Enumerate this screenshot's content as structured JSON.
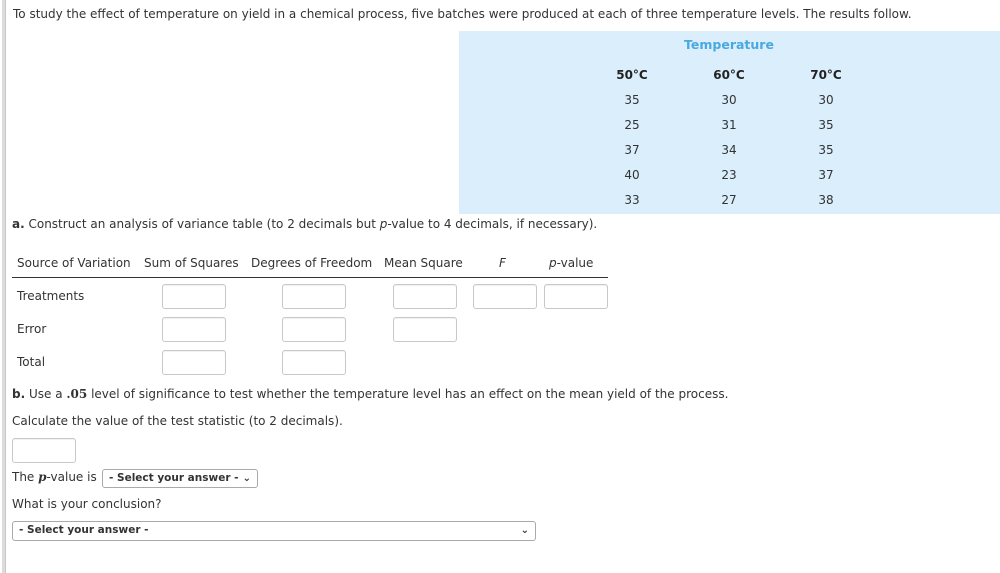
{
  "intro": "To study the effect of temperature on yield in a chemical process, five batches were produced at each of three temperature levels. The results follow.",
  "data_table": {
    "title": "Temperature",
    "columns": [
      {
        "header": "50°C",
        "values": [
          "35",
          "25",
          "37",
          "40",
          "33"
        ]
      },
      {
        "header": "60°C",
        "values": [
          "30",
          "31",
          "34",
          "23",
          "27"
        ]
      },
      {
        "header": "70°C",
        "values": [
          "30",
          "35",
          "35",
          "37",
          "38"
        ]
      }
    ]
  },
  "part_a": {
    "label": "a.",
    "text_before": " Construct an analysis of variance table (to 2 decimals but ",
    "p": "p",
    "text_after": "-value to 4 decimals, if necessary).",
    "headers": {
      "source": "Source of Variation",
      "ss": "Sum of Squares",
      "df": "Degrees of Freedom",
      "ms": "Mean Square",
      "f": "F",
      "p": "p",
      "p_suffix": "-value"
    },
    "rows": {
      "treatments": {
        "label": "Treatments",
        "ss": "",
        "df": "",
        "ms": "",
        "f": "",
        "p": ""
      },
      "error": {
        "label": "Error",
        "ss": "",
        "df": "",
        "ms": ""
      },
      "total": {
        "label": "Total",
        "ss": "",
        "df": ""
      }
    }
  },
  "part_b": {
    "label": "b.",
    "text_before": " Use a ",
    "alpha": ".05",
    "text_after": " level of significance to test whether the temperature level has an effect on the mean yield of the process.",
    "calc_text": "Calculate the value of the test statistic (to 2 decimals).",
    "test_statistic_value": "",
    "pvalue_label_before": "The ",
    "pvalue_p": "p",
    "pvalue_label_after": "-value is",
    "pvalue_select": "- Select your answer -",
    "conclusion_label": "What is your conclusion?",
    "conclusion_select": "- Select your answer -"
  },
  "icons": {
    "chevron": "⌄"
  }
}
